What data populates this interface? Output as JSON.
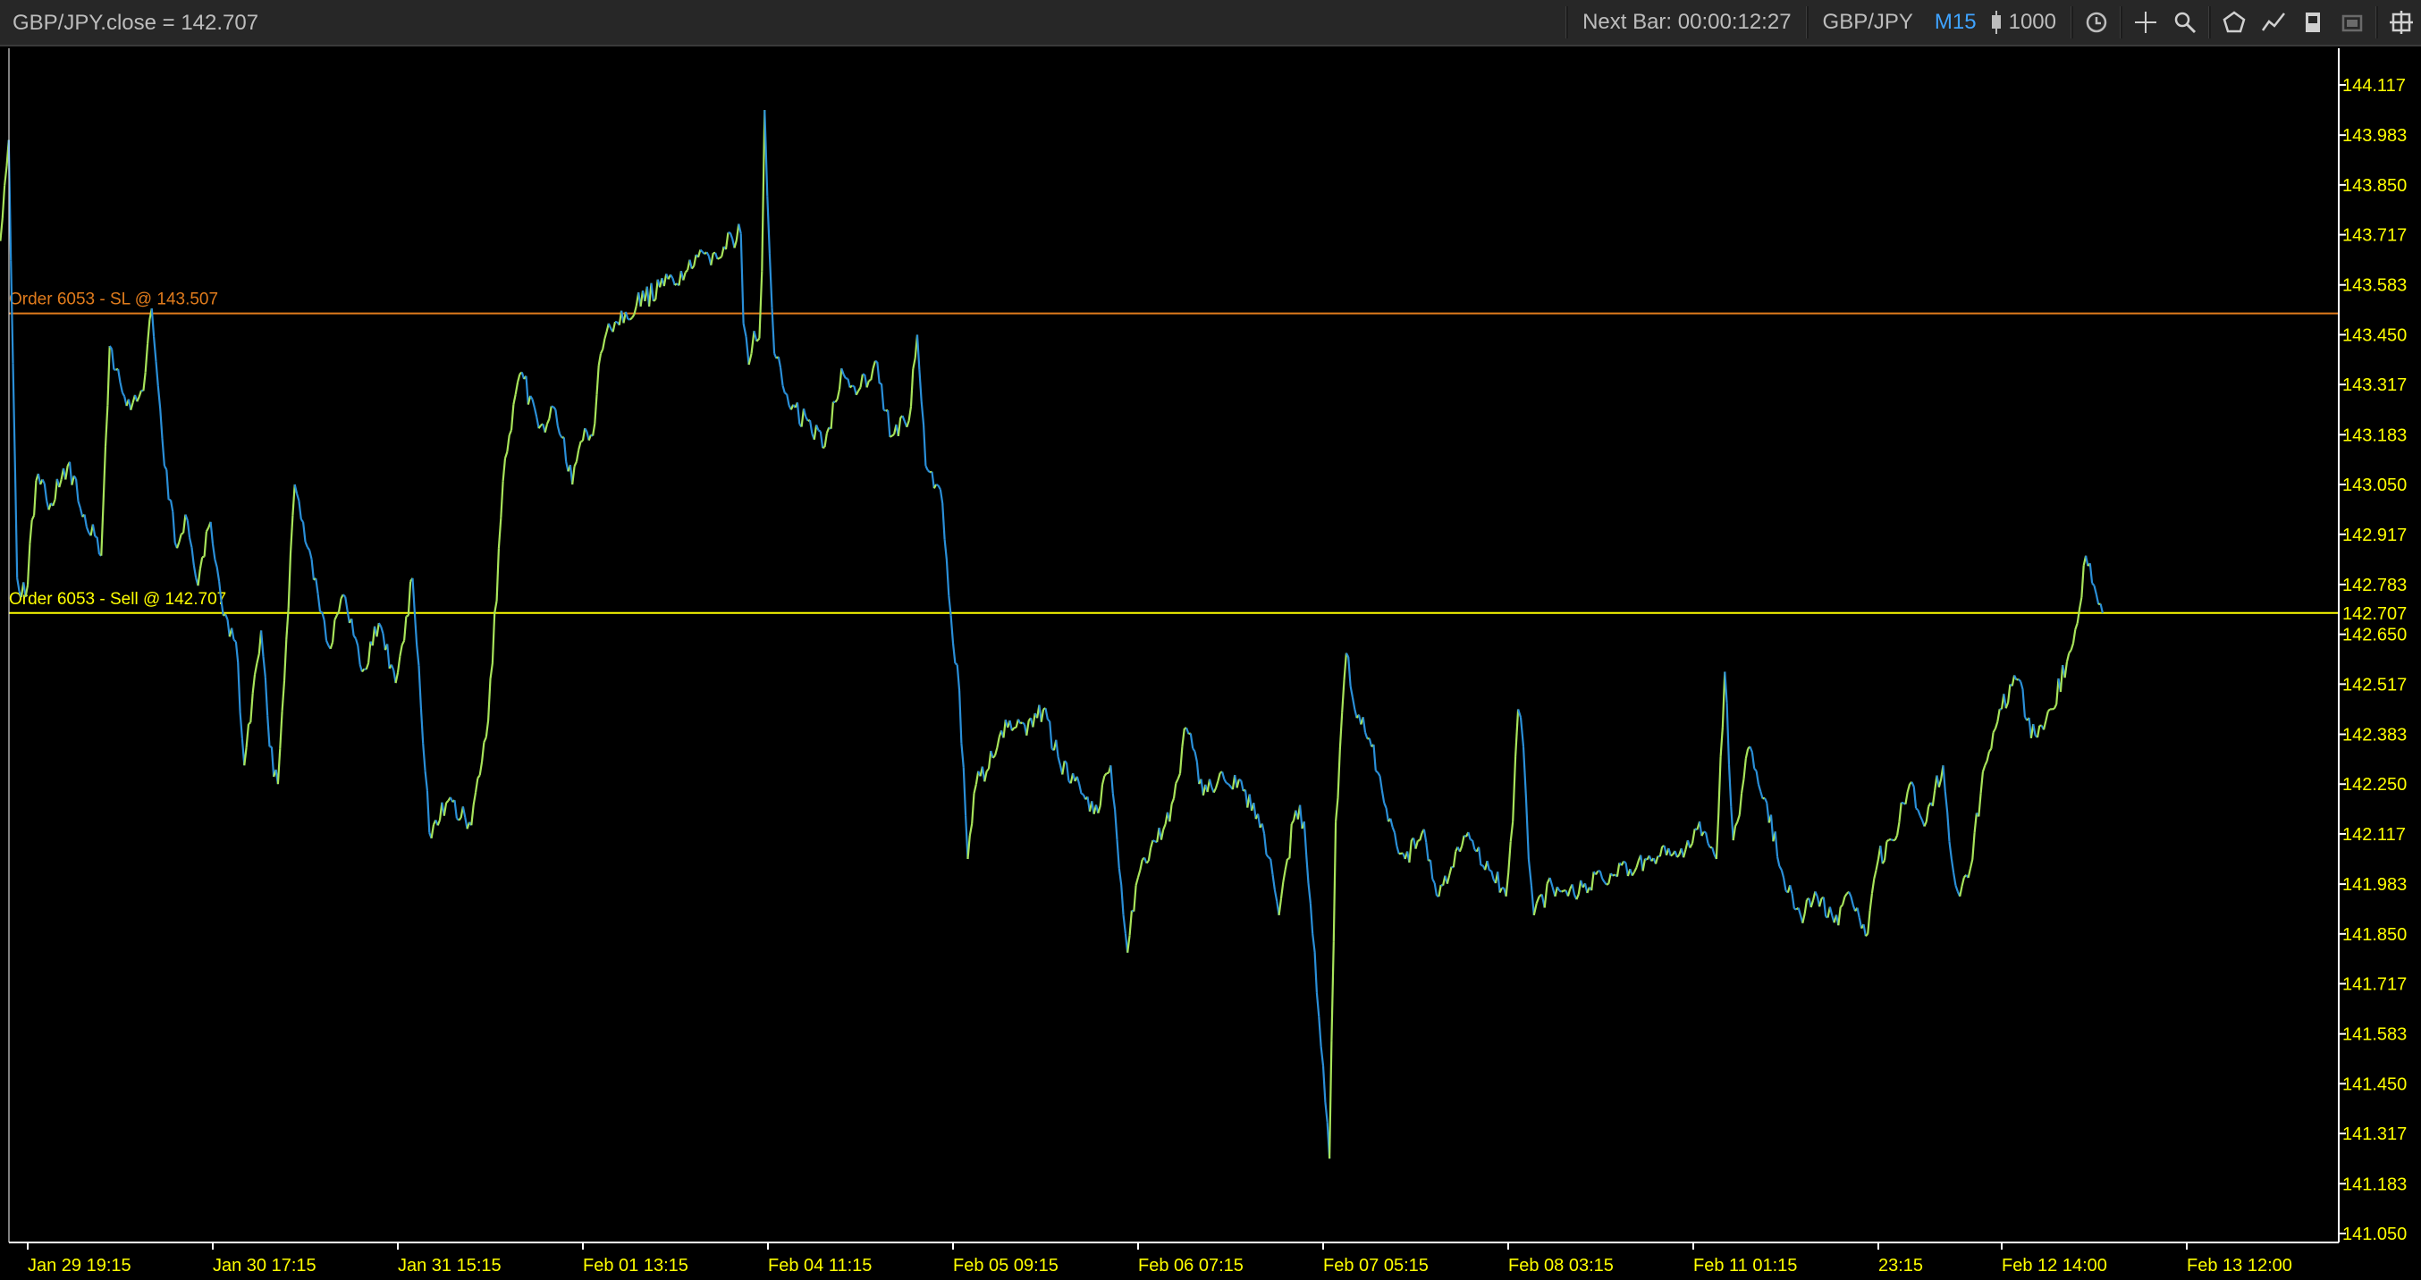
{
  "toolbar": {
    "series_readout": "GBP/JPY.close = 142.707",
    "next_bar": "Next Bar: 00:00:12:27",
    "symbol": "GBP/JPY",
    "timeframe": "M15",
    "bar_count": "1000",
    "icons": [
      "candle-icon",
      "sync-icon",
      "crosshair-icon",
      "zoom-icon",
      "drawing-shape-icon",
      "indicator-icon",
      "template-icon",
      "screenshot-icon",
      "settings-icon"
    ]
  },
  "colors": {
    "background": "#000000",
    "toolbar": "#272727",
    "up": "#a8e45a",
    "down": "#2a8fd8",
    "axis_text": "#ffff00",
    "sl_line": "#e07b1c",
    "order_line": "#ffff00",
    "axis_line": "#ffffff"
  },
  "chart_data": {
    "type": "line",
    "series": [
      {
        "points": [
          [
            "Jan 29 16:00",
            143.7
          ],
          [
            "Jan 29 17:00",
            143.97
          ],
          [
            "Jan 29 18:00",
            142.8
          ],
          [
            "Jan 29 19:00",
            142.75
          ],
          [
            "Jan 29 20:15",
            143.06
          ],
          [
            "Jan 29 22:00",
            143.0
          ],
          [
            "Jan 30 00:00",
            143.1
          ],
          [
            "Jan 30 02:00",
            142.97
          ],
          [
            "Jan 30 04:00",
            142.86
          ],
          [
            "Jan 30 05:00",
            143.42
          ],
          [
            "Jan 30 07:00",
            143.26
          ],
          [
            "Jan 30 09:00",
            143.3
          ],
          [
            "Jan 30 10:00",
            143.52
          ],
          [
            "Jan 30 11:30",
            143.1
          ],
          [
            "Jan 30 13:00",
            142.88
          ],
          [
            "Jan 30 14:00",
            142.97
          ],
          [
            "Jan 30 15:30",
            142.78
          ],
          [
            "Jan 30 17:00",
            142.95
          ],
          [
            "Jan 30 18:30",
            142.7
          ],
          [
            "Jan 30 20:00",
            142.63
          ],
          [
            "Jan 30 21:00",
            142.3
          ],
          [
            "Jan 30 23:00",
            142.66
          ],
          [
            "Jan 31 00:00",
            142.35
          ],
          [
            "Jan 31 01:00",
            142.25
          ],
          [
            "Jan 31 03:00",
            143.05
          ],
          [
            "Jan 31 05:00",
            142.85
          ],
          [
            "Jan 31 07:00",
            142.62
          ],
          [
            "Jan 31 09:00",
            142.75
          ],
          [
            "Jan 31 11:00",
            142.55
          ],
          [
            "Jan 31 13:00",
            142.68
          ],
          [
            "Jan 31 15:00",
            142.52
          ],
          [
            "Jan 31 17:00",
            142.8
          ],
          [
            "Jan 31 19:00",
            142.12
          ],
          [
            "Jan 31 21:00",
            142.2
          ],
          [
            "Feb 01 00:00",
            142.14
          ],
          [
            "Feb 01 02:00",
            142.42
          ],
          [
            "Feb 01 04:00",
            143.12
          ],
          [
            "Feb 01 06:00",
            143.35
          ],
          [
            "Feb 01 08:00",
            143.2
          ],
          [
            "Feb 01 10:00",
            143.25
          ],
          [
            "Feb 01 12:00",
            143.05
          ],
          [
            "Feb 01 14:00",
            143.2
          ],
          [
            "Feb 01 17:00",
            143.18
          ],
          [
            "Feb 01 20:00",
            143.4
          ],
          [
            "Feb 01 23:00",
            143.48
          ],
          [
            "Feb 04 01:00",
            143.72
          ],
          [
            "Feb 04 02:00",
            143.48
          ],
          [
            "Feb 04 04:00",
            143.37
          ],
          [
            "Feb 04 06:00",
            143.46
          ],
          [
            "Feb 04 08:00",
            143.44
          ],
          [
            "Feb 04 09:00",
            143.62
          ],
          [
            "Feb 04 10:00",
            144.05
          ],
          [
            "Feb 04 11:00",
            143.82
          ],
          [
            "Feb 04 12:00",
            143.4
          ],
          [
            "Feb 04 14:00",
            143.25
          ],
          [
            "Feb 04 16:00",
            143.22
          ],
          [
            "Feb 04 18:00",
            143.15
          ],
          [
            "Feb 04 20:00",
            143.36
          ],
          [
            "Feb 04 22:00",
            143.3
          ],
          [
            "Feb 05 00:00",
            143.38
          ],
          [
            "Feb 05 02:00",
            143.18
          ],
          [
            "Feb 05 04:00",
            143.22
          ],
          [
            "Feb 05 05:00",
            143.45
          ],
          [
            "Feb 05 06:00",
            143.1
          ],
          [
            "Feb 05 08:00",
            143.0
          ],
          [
            "Feb 05 09:00",
            142.7
          ],
          [
            "Feb 05 10:00",
            142.5
          ],
          [
            "Feb 05 11:00",
            142.05
          ],
          [
            "Feb 05 12:00",
            142.25
          ],
          [
            "Feb 05 14:00",
            142.32
          ],
          [
            "Feb 05 16:00",
            142.42
          ],
          [
            "Feb 05 18:00",
            142.38
          ],
          [
            "Feb 05 20:00",
            142.45
          ],
          [
            "Feb 05 22:00",
            142.3
          ],
          [
            "Feb 06 00:00",
            142.27
          ],
          [
            "Feb 06 02:00",
            142.17
          ],
          [
            "Feb 06 04:00",
            142.3
          ],
          [
            "Feb 06 06:00",
            141.8
          ],
          [
            "Feb 06 07:00",
            141.98
          ],
          [
            "Feb 06 09:00",
            142.1
          ],
          [
            "Feb 06 11:00",
            142.15
          ],
          [
            "Feb 06 13:00",
            142.4
          ],
          [
            "Feb 06 15:00",
            142.22
          ],
          [
            "Feb 06 17:00",
            142.28
          ],
          [
            "Feb 06 19:00",
            142.24
          ],
          [
            "Feb 06 21:00",
            142.2
          ],
          [
            "Feb 06 23:00",
            142.05
          ],
          [
            "Feb 07 00:00",
            141.9
          ],
          [
            "Feb 07 01:00",
            142.05
          ],
          [
            "Feb 07 02:00",
            142.18
          ],
          [
            "Feb 07 03:00",
            142.15
          ],
          [
            "Feb 07 04:00",
            141.85
          ],
          [
            "Feb 07 05:00",
            141.55
          ],
          [
            "Feb 07 06:00",
            141.25
          ],
          [
            "Feb 07 06:45",
            142.15
          ],
          [
            "Feb 07 08:00",
            142.6
          ],
          [
            "Feb 07 09:00",
            142.45
          ],
          [
            "Feb 07 11:00",
            142.35
          ],
          [
            "Feb 07 13:00",
            142.15
          ],
          [
            "Feb 07 15:00",
            142.05
          ],
          [
            "Feb 07 17:00",
            142.12
          ],
          [
            "Feb 07 19:00",
            141.95
          ],
          [
            "Feb 07 21:00",
            142.07
          ],
          [
            "Feb 07 23:00",
            142.1
          ],
          [
            "Feb 08 01:00",
            142.02
          ],
          [
            "Feb 08 03:00",
            141.95
          ],
          [
            "Feb 08 05:00",
            142.15
          ],
          [
            "Feb 08 07:00",
            142.45
          ],
          [
            "Feb 08 09:00",
            142.35
          ],
          [
            "Feb 08 11:00",
            142.05
          ],
          [
            "Feb 08 13:00",
            141.9
          ],
          [
            "Feb 08 15:00",
            141.95
          ],
          [
            "Feb 08 17:00",
            141.92
          ],
          [
            "Feb 08 19:00",
            142.0
          ],
          [
            "Feb 08 21:00",
            141.95
          ],
          [
            "Feb 11 00:00",
            142.08
          ],
          [
            "Feb 11 02:00",
            142.15
          ],
          [
            "Feb 11 04:00",
            142.05
          ],
          [
            "Feb 11 05:00",
            142.55
          ],
          [
            "Feb 11 06:00",
            142.1
          ],
          [
            "Feb 11 08:00",
            142.35
          ],
          [
            "Feb 11 10:00",
            142.2
          ],
          [
            "Feb 11 12:00",
            142.0
          ],
          [
            "Feb 11 14:00",
            141.9
          ],
          [
            "Feb 11 16:00",
            141.95
          ],
          [
            "Feb 11 18:00",
            141.88
          ],
          [
            "Feb 11 20:00",
            141.95
          ],
          [
            "Feb 11 22:00",
            141.85
          ],
          [
            "Feb 11 23:15",
            142.05
          ],
          [
            "Feb 12 01:00",
            142.1
          ],
          [
            "Feb 12 03:00",
            142.25
          ],
          [
            "Feb 12 05:00",
            142.15
          ],
          [
            "Feb 12 07:00",
            142.3
          ],
          [
            "Feb 12 08:00",
            142.05
          ],
          [
            "Feb 12 09:00",
            141.95
          ],
          [
            "Feb 12 10:00",
            142.0
          ],
          [
            "Feb 12 12:00",
            142.3
          ],
          [
            "Feb 12 14:00",
            142.45
          ],
          [
            "Feb 12 16:00",
            142.53
          ],
          [
            "Feb 12 17:00",
            142.42
          ],
          [
            "Feb 12 18:00",
            142.38
          ],
          [
            "Feb 12 20:00",
            142.45
          ],
          [
            "Feb 12 22:00",
            142.6
          ],
          [
            "Feb 12 23:00",
            142.68
          ],
          [
            "Feb 13 00:00",
            142.86
          ],
          [
            "Feb 13 01:00",
            142.78
          ],
          [
            "Feb 13 02:00",
            142.707
          ]
        ]
      }
    ],
    "x_tick_labels": [
      "Jan 29 19:15",
      "Jan 30 17:15",
      "Jan 31 15:15",
      "Feb 01 13:15",
      "Feb 04 11:15",
      "Feb 05 09:15",
      "Feb 06 07:15",
      "Feb 07 05:15",
      "Feb 08 03:15",
      "Feb 11 01:15",
      "23:15",
      "Feb 12 14:00",
      "Feb 13 12:00"
    ],
    "y_tick_labels": [
      "144.117",
      "143.983",
      "143.850",
      "143.717",
      "143.583",
      "143.450",
      "143.317",
      "143.183",
      "143.050",
      "142.917",
      "142.783",
      "142.650",
      "142.517",
      "142.383",
      "142.250",
      "142.117",
      "141.983",
      "141.850",
      "141.717",
      "141.583",
      "141.450",
      "141.317",
      "141.183",
      "141.050"
    ],
    "ylim": [
      141.03,
      144.18
    ],
    "price_lines": [
      {
        "label": "Order 6053 - SL @ 143.507",
        "price": 143.507
      },
      {
        "label": "Order 6053 - Sell @ 142.707",
        "price": 142.707
      }
    ],
    "current_price_label": "142.707",
    "grid": false
  }
}
